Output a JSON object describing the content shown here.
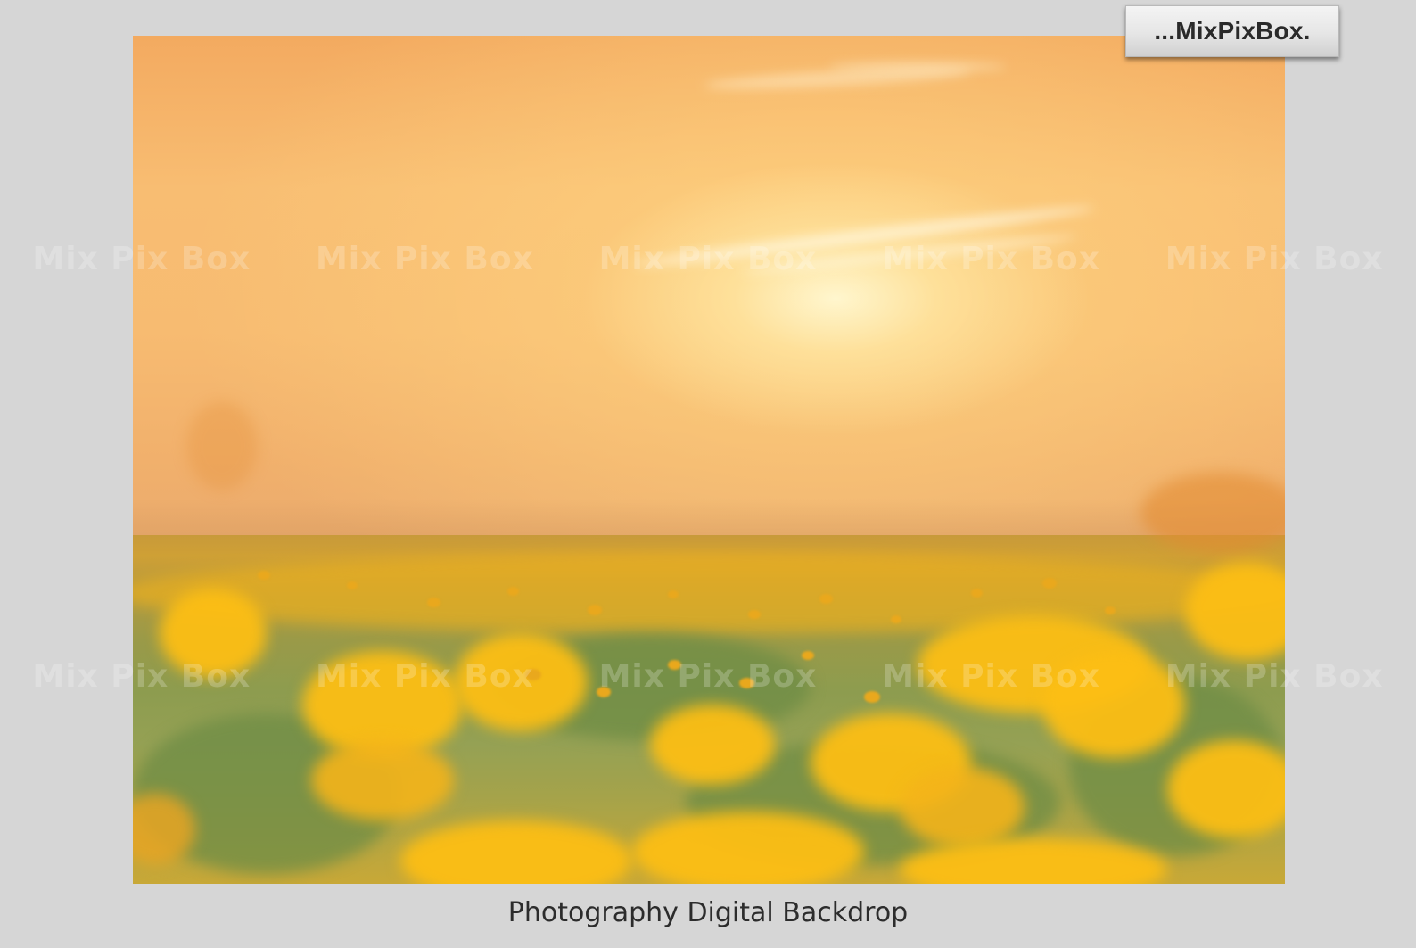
{
  "brand": {
    "label": "...MixPixBox."
  },
  "watermark": {
    "text": "Mix Pix Box"
  },
  "caption": {
    "text": "Photography Digital Backdrop"
  },
  "photo": {
    "subject": "sunset over yellow wildflower field",
    "colors": {
      "sky": "#f6b86e",
      "flowers": "#f4b418",
      "foliage": "#8d9c4f",
      "background": "#d6d6d6"
    }
  }
}
